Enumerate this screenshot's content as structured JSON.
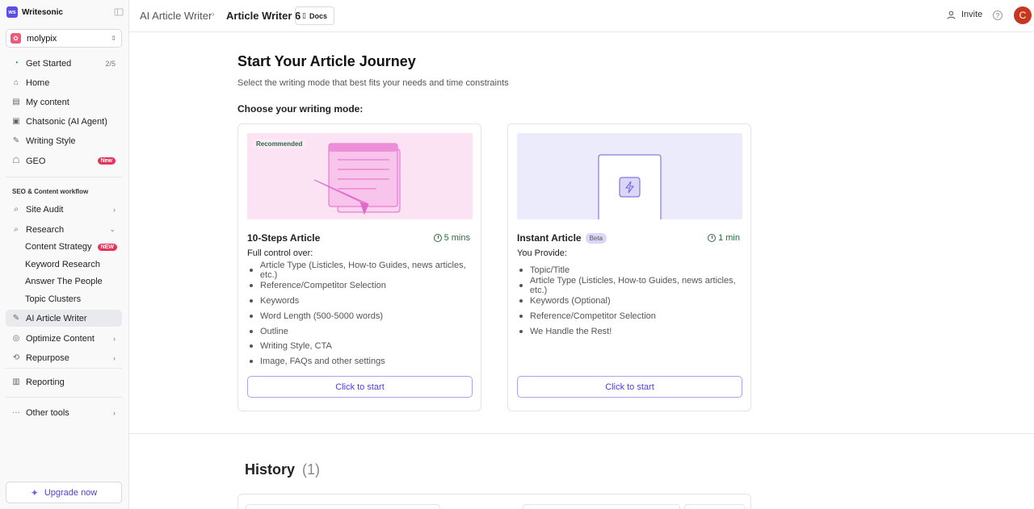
{
  "brand": {
    "name": "Writesonic",
    "logo_text": "ws"
  },
  "workspace": {
    "name": "molypix"
  },
  "sidebar": {
    "items": [
      {
        "label": "Get Started",
        "right": "2/5"
      },
      {
        "label": "Home"
      },
      {
        "label": "My content"
      },
      {
        "label": "Chatsonic (AI Agent)"
      },
      {
        "label": "Writing Style"
      },
      {
        "label": "GEO",
        "badge": "New"
      }
    ],
    "section_title": "SEO & Content workflow",
    "seo_items": [
      {
        "label": "Site Audit"
      },
      {
        "label": "Research"
      }
    ],
    "research_sub": [
      {
        "label": "Content Strategy",
        "badge": "NEW"
      },
      {
        "label": "Keyword Research"
      },
      {
        "label": "Answer The People"
      },
      {
        "label": "Topic Clusters"
      }
    ],
    "lower_items": [
      {
        "label": "AI Article Writer"
      },
      {
        "label": "Optimize Content"
      },
      {
        "label": "Repurpose"
      }
    ],
    "reporting": "Reporting",
    "other_tools": "Other tools",
    "upgrade": "Upgrade now"
  },
  "topbar": {
    "crumb1": "AI Article Writer",
    "crumb2": "Article Writer 6",
    "docs": "Docs",
    "invite": "Invite",
    "avatar_initial": "C"
  },
  "main": {
    "title": "Start Your Article Journey",
    "subtitle": "Select the writing mode that best fits your needs and time constraints",
    "choose_label": "Choose your writing mode:",
    "cards": [
      {
        "badge": "Recommended",
        "title": "10-Steps Article",
        "time": "5 mins",
        "label": "Full control over:",
        "items": [
          "Article Type (Listicles, How-to Guides, news articles, etc.)",
          "Reference/Competitor Selection",
          "Keywords",
          "Word Length (500-5000 words)",
          "Outline",
          "Writing Style, CTA",
          "Image, FAQs and other settings"
        ],
        "button": "Click to start"
      },
      {
        "title": "Instant Article",
        "beta": "Beta",
        "time": "1 min",
        "label": "You Provide:",
        "items": [
          "Topic/Title",
          "Article Type (Listicles, How-to Guides, news articles, etc.)",
          "Keywords (Optional)",
          "Reference/Competitor Selection",
          "We Handle the Rest!"
        ],
        "button": "Click to start"
      }
    ],
    "history_label": "History",
    "history_count": "(1)"
  },
  "colors": {
    "accent": "#4b3fd6",
    "brand": "#5b4fe9",
    "green": "#2c6b3d",
    "badge_red": "#e8335b"
  }
}
